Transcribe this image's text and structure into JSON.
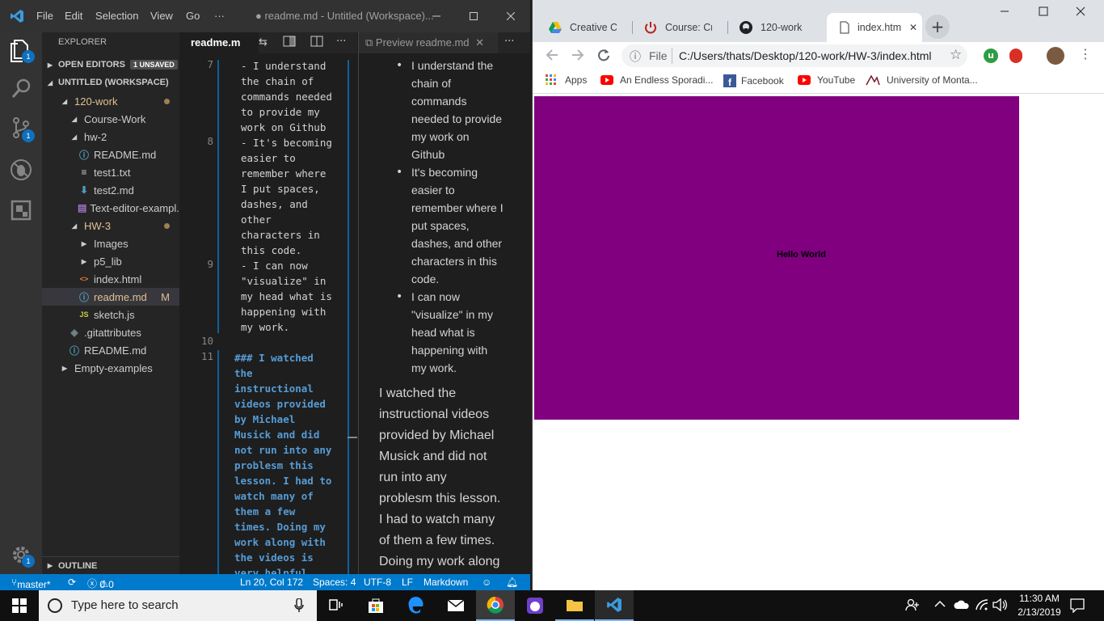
{
  "vscode": {
    "menu": [
      "File",
      "Edit",
      "Selection",
      "View",
      "Go",
      "···"
    ],
    "window_title": "● readme.md - Untitled (Workspace)...",
    "activity_badges": [
      "1",
      "1",
      "1"
    ],
    "explorer_title": "EXPLORER",
    "open_editors": {
      "label": "OPEN EDITORS",
      "badge": "1 UNSAVED"
    },
    "workspace_label": "UNTITLED (WORKSPACE)",
    "tree": [
      {
        "label": "120-work",
        "icon": "expanded",
        "indent": 1,
        "modified_dot": true,
        "color": "#e2c08d"
      },
      {
        "label": "Course-Work",
        "icon": "expanded",
        "indent": 2
      },
      {
        "label": "hw-2",
        "icon": "expanded",
        "indent": 2
      },
      {
        "label": "README.md",
        "icon": "info",
        "indent": 3
      },
      {
        "label": "test1.txt",
        "icon": "lines",
        "indent": 3
      },
      {
        "label": "test2.md",
        "icon": "arrow-down",
        "indent": 3
      },
      {
        "label": "Text-editor-exampl...",
        "icon": "image",
        "indent": 3
      },
      {
        "label": "HW-3",
        "icon": "expanded",
        "indent": 2,
        "modified_dot": true,
        "color": "#e2c08d"
      },
      {
        "label": "Images",
        "icon": "collapsed",
        "indent": 3
      },
      {
        "label": "p5_lib",
        "icon": "collapsed",
        "indent": 3
      },
      {
        "label": "index.html",
        "icon": "code",
        "indent": 3
      },
      {
        "label": "readme.md",
        "icon": "info",
        "indent": 3,
        "badge": "M",
        "color": "#e2c08d"
      },
      {
        "label": "sketch.js",
        "icon": "js",
        "indent": 3
      },
      {
        "label": ".gitattributes",
        "icon": "diamond",
        "indent": 2
      },
      {
        "label": "README.md",
        "icon": "info",
        "indent": 2
      },
      {
        "label": "Empty-examples",
        "icon": "collapsed",
        "indent": 1
      }
    ],
    "outline_label": "OUTLINE",
    "editor_tab": "readme.m",
    "preview_tab": "Preview readme.md",
    "code_lines": [
      {
        "num": "7",
        "text": "- I understand"
      },
      {
        "num": "",
        "text": "the chain of"
      },
      {
        "num": "",
        "text": "commands needed"
      },
      {
        "num": "",
        "text": "to provide my"
      },
      {
        "num": "",
        "text": "work on Github"
      },
      {
        "num": "8",
        "text": "- It's becoming"
      },
      {
        "num": "",
        "text": "easier to"
      },
      {
        "num": "",
        "text": "remember where"
      },
      {
        "num": "",
        "text": "I put spaces,"
      },
      {
        "num": "",
        "text": "dashes, and"
      },
      {
        "num": "",
        "text": "other"
      },
      {
        "num": "",
        "text": "characters in"
      },
      {
        "num": "",
        "text": "this code."
      },
      {
        "num": "9",
        "text": "- I can now"
      },
      {
        "num": "",
        "text": "\"visualize\" in"
      },
      {
        "num": "",
        "text": "my head what is"
      },
      {
        "num": "",
        "text": "happening with"
      },
      {
        "num": "",
        "text": "my work."
      },
      {
        "num": "10",
        "text": ""
      }
    ],
    "heading_lines": [
      {
        "num": "11",
        "text": "### I watched"
      },
      {
        "num": "",
        "text": "the"
      },
      {
        "num": "",
        "text": "instructional"
      },
      {
        "num": "",
        "text": "videos provided"
      },
      {
        "num": "",
        "text": "by Michael"
      },
      {
        "num": "",
        "text": "Musick and did"
      },
      {
        "num": "",
        "text": "not run into any"
      },
      {
        "num": "",
        "text": "problesm this"
      },
      {
        "num": "",
        "text": "lesson. I had to"
      },
      {
        "num": "",
        "text": "watch many of"
      },
      {
        "num": "",
        "text": "them a few"
      },
      {
        "num": "",
        "text": "times. Doing my"
      },
      {
        "num": "",
        "text": "work along with"
      },
      {
        "num": "",
        "text": "the videos is"
      },
      {
        "num": "",
        "text": "very helpful"
      }
    ],
    "preview_bullets": [
      [
        "I understand the",
        "chain of",
        "commands",
        "needed to provide",
        "my work on",
        "Github"
      ],
      [
        "It's becoming",
        "easier to",
        "remember where I",
        "put spaces,",
        "dashes, and other",
        "characters in this",
        "code."
      ],
      [
        "I can now",
        "\"visualize\" in my",
        "head what is",
        "happening with",
        "my work."
      ]
    ],
    "preview_heading": [
      "I watched the",
      "instructional videos",
      "provided by Michael",
      "Musick and did not",
      "run into any",
      "problesm this lesson.",
      "I had to watch many",
      "of them a few times.",
      "Doing my work along"
    ],
    "status": {
      "branch": "master*",
      "errors": "0",
      "warnings": "0",
      "position": "Ln 20, Col 172",
      "spaces": "Spaces: 4",
      "encoding": "UTF-8",
      "eol": "LF",
      "language": "Markdown"
    }
  },
  "chrome": {
    "tabs": [
      {
        "title": "Creative C",
        "icon": "drive-icon"
      },
      {
        "title": "Course: Cr",
        "icon": "power-icon"
      },
      {
        "title": "120-work",
        "icon": "github-icon"
      },
      {
        "title": "index.htm",
        "icon": "file-icon",
        "active": true
      }
    ],
    "url_scheme": "File",
    "url": "C:/Users/thats/Desktop/120-work/HW-3/index.html",
    "bookmarks": [
      {
        "label": "Apps",
        "icon": "apps-icon"
      },
      {
        "label": "An Endless Sporadi...",
        "icon": "youtube-icon"
      },
      {
        "label": "Facebook",
        "icon": "facebook-icon"
      },
      {
        "label": "YouTube",
        "icon": "youtube-icon"
      },
      {
        "label": "University of Monta...",
        "icon": "umt-icon"
      }
    ],
    "canvas_text": "Hello World",
    "canvas_color": "#800080"
  },
  "taskbar": {
    "search_placeholder": "Type here to search",
    "time": "11:30 AM",
    "date": "2/13/2019"
  }
}
